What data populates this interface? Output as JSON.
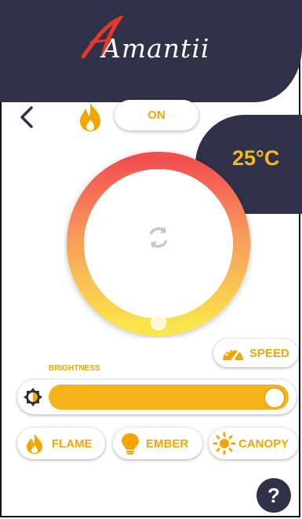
{
  "brand": {
    "logo_text": "Amantii"
  },
  "controls": {
    "power_state": "ON",
    "temperature": "25°C"
  },
  "speed": {
    "label": "SPEED"
  },
  "brightness": {
    "label": "BRIGHTNESS",
    "level_percent": 100
  },
  "modes": [
    {
      "label": "FLAME",
      "icon": "flame-icon"
    },
    {
      "label": "EMBER",
      "icon": "bulb-icon"
    },
    {
      "label": "CANOPY",
      "icon": "sun-icon"
    }
  ],
  "help": {
    "label": "?"
  },
  "colors": {
    "accent": "#f3a500",
    "dark": "#2f3249",
    "flame_red": "#e8382a"
  }
}
